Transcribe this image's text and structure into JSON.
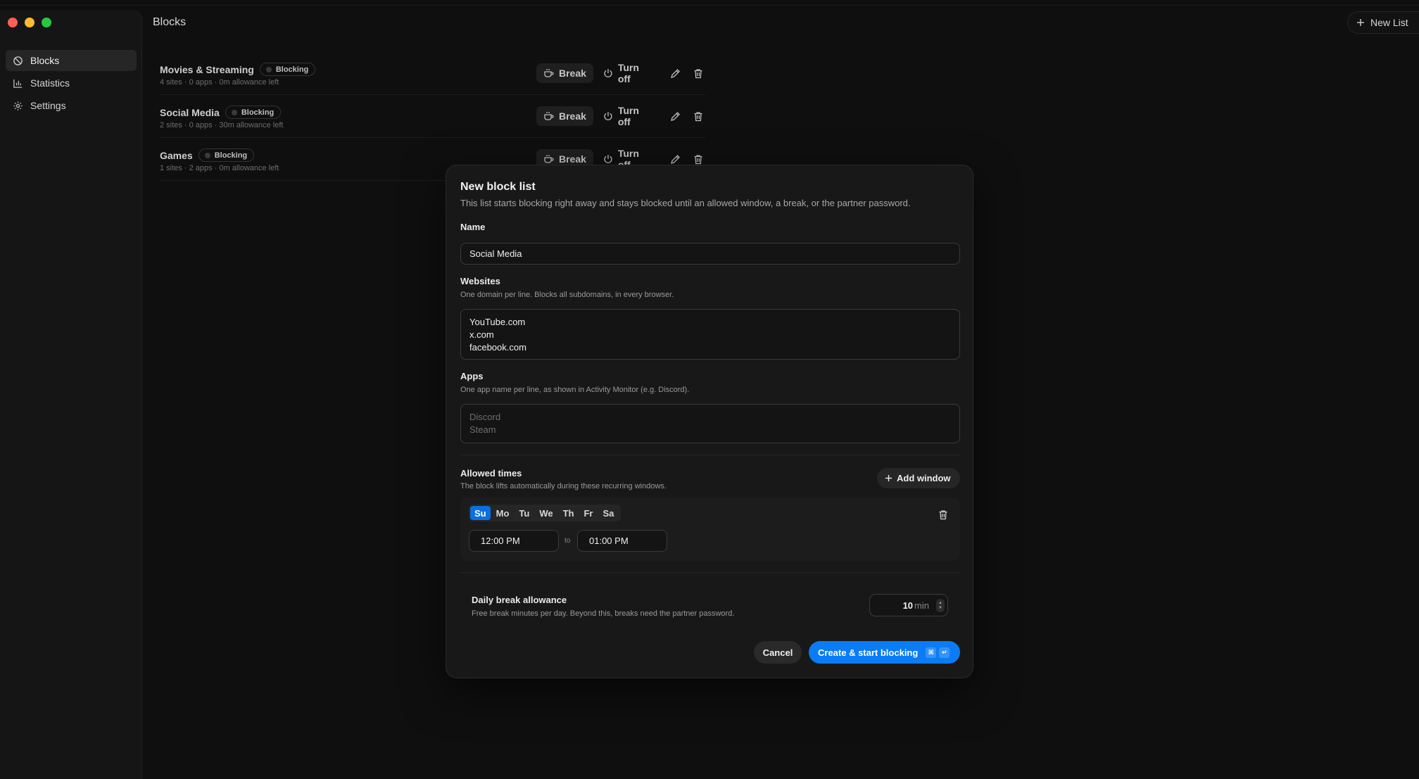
{
  "header": {
    "title": "Blocks",
    "new_list_label": "New List"
  },
  "sidebar": {
    "items": [
      {
        "label": "Blocks",
        "icon": "shield-icon",
        "active": true
      },
      {
        "label": "Statistics",
        "icon": "bar-chart-icon",
        "active": false
      },
      {
        "label": "Settings",
        "icon": "gear-icon",
        "active": false
      }
    ]
  },
  "lists": [
    {
      "name": "Movies & Streaming",
      "status": "Blocking",
      "summary": "4 sites · 0 apps · 0m allowance left"
    },
    {
      "name": "Social Media",
      "status": "Blocking",
      "summary": "2 sites · 0 apps · 30m allowance left"
    },
    {
      "name": "Games",
      "status": "Blocking",
      "summary": "1 sites · 2 apps · 0m allowance left"
    }
  ],
  "row_actions": {
    "break_label": "Break",
    "turn_off_label": "Turn off"
  },
  "modal": {
    "title": "New block list",
    "description": "This list starts blocking right away and stays blocked until an allowed window, a break, or the partner password.",
    "name": {
      "label": "Name",
      "value": "Social Media"
    },
    "websites": {
      "label": "Websites",
      "hint": "One domain per line. Blocks all subdomains, in every browser.",
      "lines": [
        "YouTube.com",
        "x.com",
        "facebook.com"
      ]
    },
    "apps": {
      "label": "Apps",
      "hint": "One app name per line, as shown in Activity Monitor (e.g. Discord).",
      "placeholder_lines": [
        "Discord",
        "Steam"
      ]
    },
    "allowed_times": {
      "label": "Allowed times",
      "hint": "The block lifts automatically during these recurring windows.",
      "add_label": "Add window",
      "window": {
        "days": [
          {
            "label": "Su",
            "selected": true
          },
          {
            "label": "Mo",
            "selected": false
          },
          {
            "label": "Tu",
            "selected": false
          },
          {
            "label": "We",
            "selected": false
          },
          {
            "label": "Th",
            "selected": false
          },
          {
            "label": "Fr",
            "selected": false
          },
          {
            "label": "Sa",
            "selected": false
          }
        ],
        "start": "12:00 PM",
        "to_label": "to",
        "end": "01:00 PM"
      }
    },
    "allowance": {
      "label": "Daily break allowance",
      "hint": "Free break minutes per day. Beyond this, breaks need the partner password.",
      "value": "10",
      "unit": "min"
    },
    "cancel_label": "Cancel",
    "create_label": "Create & start blocking",
    "shortcut": [
      "⌘",
      "↵"
    ]
  },
  "colors": {
    "accent": "#0a7cf5",
    "background": "#0f0f0f",
    "modal": "#181818"
  }
}
